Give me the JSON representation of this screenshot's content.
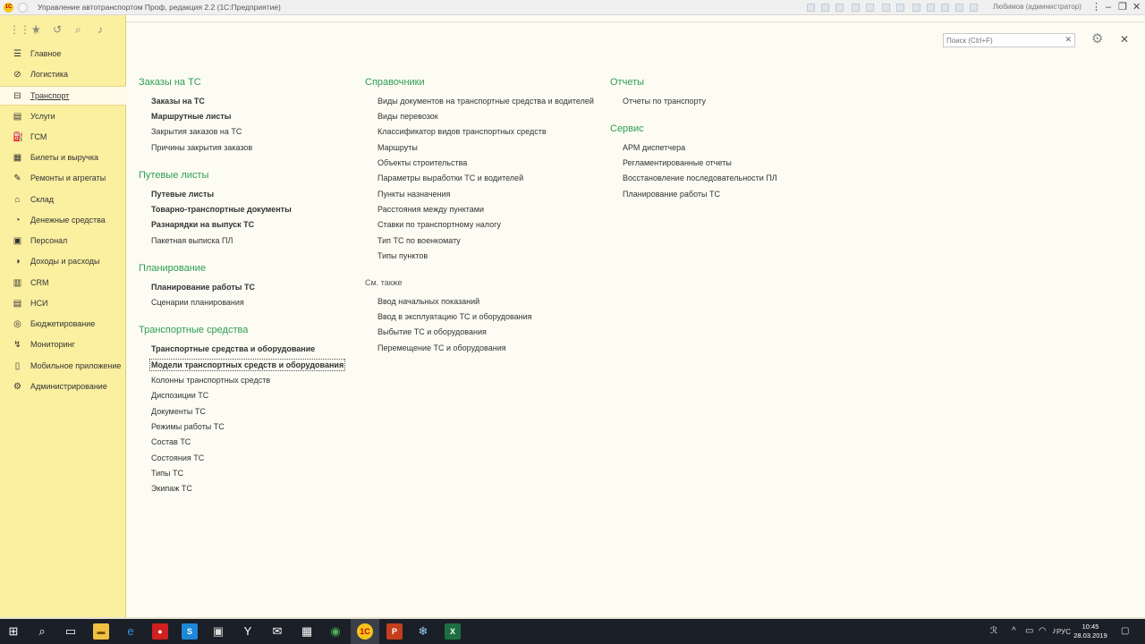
{
  "window": {
    "logo": "1С",
    "title": "Управление автотранспортом Проф, редакция 2.2  (1С:Предприятие)",
    "user": "Любимов (администратор)"
  },
  "sidebar": {
    "items": [
      {
        "label": "Главное",
        "icon": "☰"
      },
      {
        "label": "Логистика",
        "icon": "⊘"
      },
      {
        "label": "Транспорт",
        "icon": "⊟"
      },
      {
        "label": "Услуги",
        "icon": "▤"
      },
      {
        "label": "ГСМ",
        "icon": "⛽"
      },
      {
        "label": "Билеты и выручка",
        "icon": "▦"
      },
      {
        "label": "Ремонты и агрегаты",
        "icon": "✎"
      },
      {
        "label": "Склад",
        "icon": "⌂"
      },
      {
        "label": "Денежные средства",
        "icon": "◔"
      },
      {
        "label": "Персонал",
        "icon": "▣"
      },
      {
        "label": "Доходы и расходы",
        "icon": "◑"
      },
      {
        "label": "CRM",
        "icon": "▥"
      },
      {
        "label": "НСИ",
        "icon": "▤"
      },
      {
        "label": "Бюджетирование",
        "icon": "◎"
      },
      {
        "label": "Мониторинг",
        "icon": "↯"
      },
      {
        "label": "Мобильное приложение",
        "icon": "▯"
      },
      {
        "label": "Администрирование",
        "icon": "⚙"
      }
    ]
  },
  "search": {
    "placeholder": "Поиск (Ctrl+F)"
  },
  "content": {
    "orders": {
      "title": "Заказы на ТС",
      "links": [
        "Заказы на ТС",
        "Маршрутные листы",
        "Закрытия заказов на ТС",
        "Причины закрытия заказов"
      ]
    },
    "waybills": {
      "title": "Путевые листы",
      "links": [
        "Путевые листы",
        "Товарно-транспортные документы",
        "Разнарядки на выпуск ТС",
        "Пакетная выписка ПЛ"
      ]
    },
    "planning": {
      "title": "Планирование",
      "links": [
        "Планирование работы ТС",
        "Сценарии планирования"
      ]
    },
    "vehicles": {
      "title": "Транспортные средства",
      "links": [
        "Транспортные средства и оборудование",
        "Модели транспортных средств и оборудования",
        "Колонны транспортных средств",
        "Диспозиции ТС",
        "Документы ТС",
        "Режимы работы ТС",
        "Состав ТС",
        "Состояния ТС",
        "Типы ТС",
        "Экипаж ТС"
      ]
    },
    "catalogs": {
      "title": "Справочники",
      "links": [
        "Виды документов на транспортные средства и водителей",
        "Виды перевозок",
        "Классификатор видов транспортных средств",
        "Маршруты",
        "Объекты строительства",
        "Параметры выработки ТС и водителей",
        "Пункты назначения",
        "Расстояния между пунктами",
        "Ставки по транспортному налогу",
        "Тип ТС по военкомату",
        "Типы пунктов"
      ]
    },
    "see_also": {
      "title": "См. также",
      "links": [
        "Ввод начальных показаний",
        "Ввод в эксплуатацию ТС и оборудования",
        "Выбытие ТС и оборудования",
        "Перемещение ТС и оборудования"
      ]
    },
    "reports": {
      "title": "Отчеты",
      "links": [
        "Отчеты по транспорту"
      ]
    },
    "service": {
      "title": "Сервис",
      "links": [
        "АРМ диспетчера",
        "Регламентированные отчеты",
        "Восстановление последовательности ПЛ",
        "Планирование работы ТС"
      ]
    }
  },
  "taskbar": {
    "lang": "РУС",
    "time": "10:45",
    "date": "28.03.2019"
  },
  "colors": {
    "sidebar": "#fbefa0",
    "section_heading": "#2e9c52",
    "content_bg": "#fdfcf3",
    "taskbar": "#1b1f27"
  }
}
